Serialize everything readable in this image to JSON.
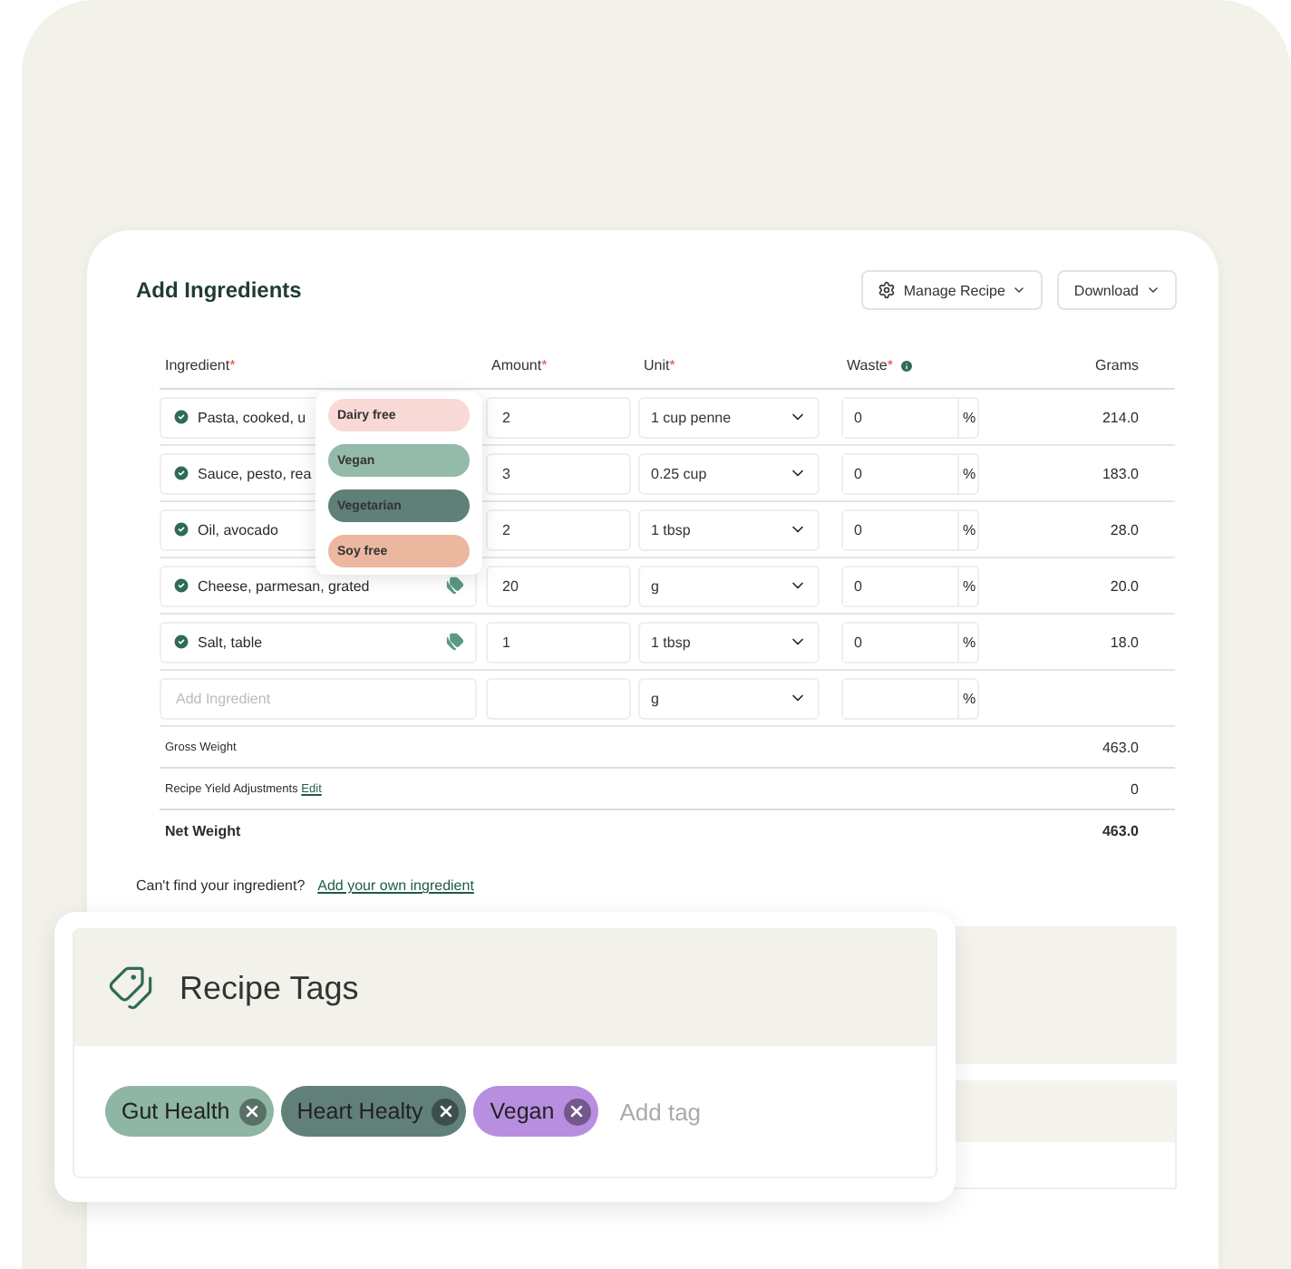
{
  "title": "Add Ingredients",
  "actions": [
    {
      "label": "Manage Recipe",
      "kind": "gear"
    },
    {
      "label": "Download",
      "kind": "plain"
    }
  ],
  "columns": [
    {
      "label": "Ingredient",
      "mark": "*"
    },
    {
      "label": "Amount",
      "mark": "*"
    },
    {
      "label": "Unit",
      "mark": "*"
    },
    {
      "label": "Waste",
      "mark": "*",
      "info": true
    },
    {
      "label": "Grams"
    }
  ],
  "rows": [
    {
      "ingredient": "Pasta, cooked, u",
      "amount": "2",
      "unit": "1 cup penne",
      "waste": "0",
      "suffix": "%",
      "grams": "214.0"
    },
    {
      "ingredient": "Sauce, pesto, rea",
      "amount": "3",
      "unit": "0.25 cup",
      "waste": "0",
      "suffix": "%",
      "grams": "183.0"
    },
    {
      "ingredient": "Oil, avocado",
      "amount": "2",
      "unit": "1 tbsp",
      "waste": "0",
      "suffix": "%",
      "grams": "28.0"
    },
    {
      "ingredient": "Cheese, parmesan, grated",
      "tagged": true,
      "amount": "20",
      "unit": "g",
      "waste": "0",
      "suffix": "%",
      "grams": "20.0"
    },
    {
      "ingredient": "Salt, table",
      "tagged": true,
      "amount": "1",
      "unit": "1 tbsp",
      "waste": "0",
      "suffix": "%",
      "grams": "18.0"
    }
  ],
  "new_row": {
    "placeholder": "Add Ingredient",
    "unit": "g",
    "suffix": "%"
  },
  "totals": [
    {
      "label": "Gross Weight",
      "value": "463.0",
      "bold": false
    },
    {
      "label": "Recipe Yield Adjustments",
      "link": "Edit",
      "value": "0",
      "bold": false
    },
    {
      "label": "Net Weight",
      "value": "463.0",
      "bold": true
    }
  ],
  "footer": {
    "text": "Can't find your ingredient?",
    "link": "Add your own ingredient"
  },
  "tag_menu": [
    {
      "label": "Dairy free",
      "color": "#f8d9d6"
    },
    {
      "label": "Vegan",
      "color": "#94bba9"
    },
    {
      "label": "Vegetarian",
      "color": "#5f7f79"
    },
    {
      "label": "Soy free",
      "color": "#ebb89f"
    }
  ],
  "recipe_tags": {
    "title": "Recipe Tags",
    "placeholder": "Add tag",
    "tags": [
      {
        "label": "Gut Health",
        "color": "#8fb5a5"
      },
      {
        "label": "Heart Healty",
        "color": "#62807a"
      },
      {
        "label": "Vegan",
        "color": "#b88ee0"
      }
    ]
  }
}
